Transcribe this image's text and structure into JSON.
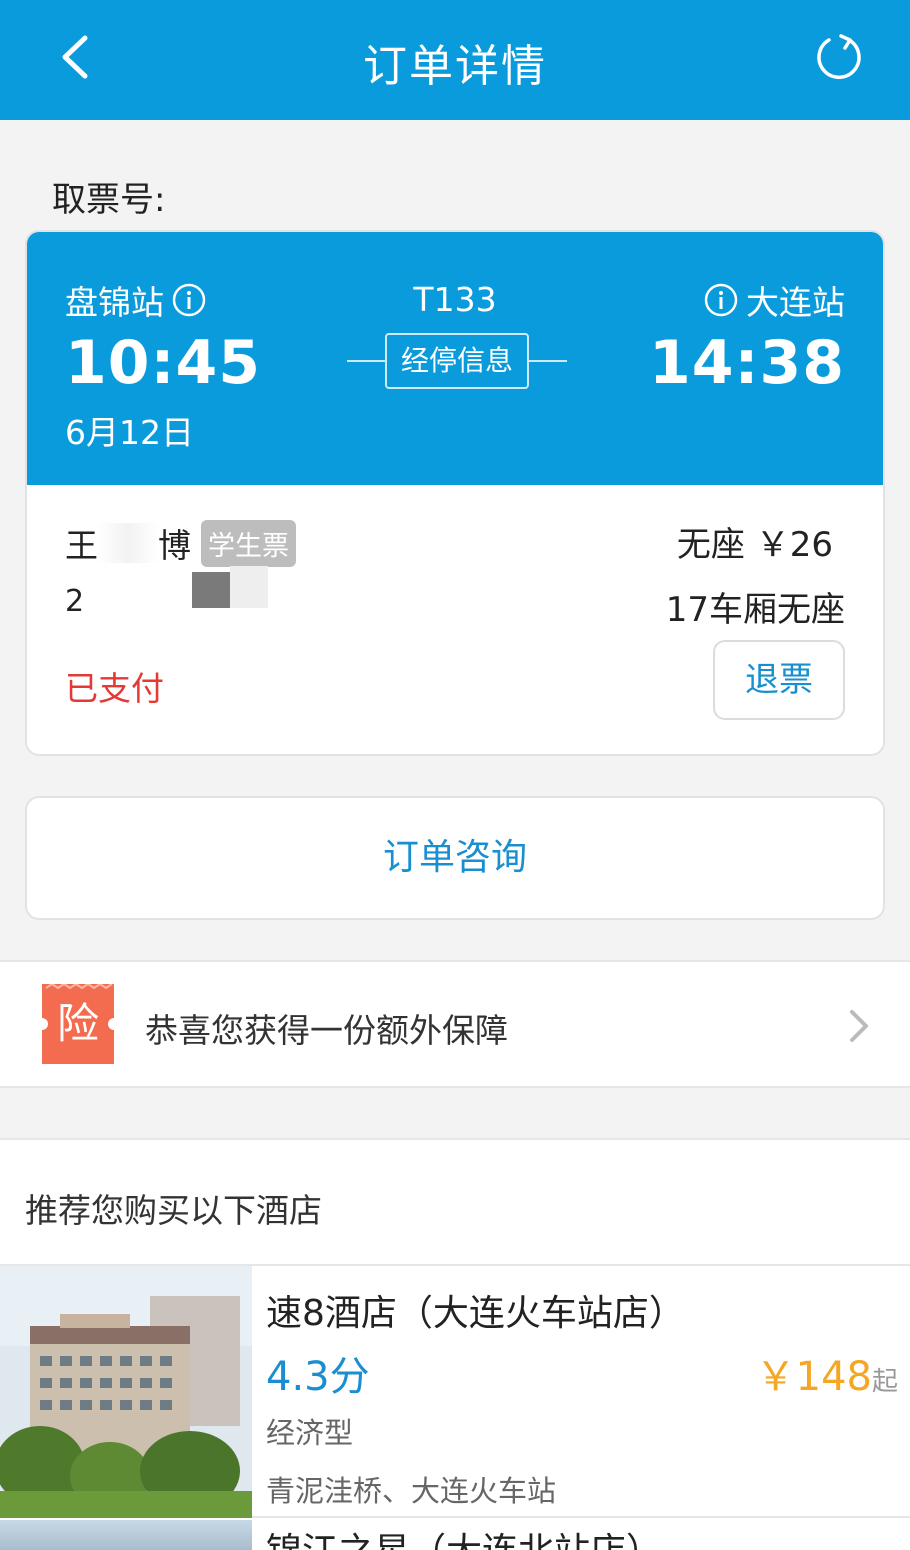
{
  "header": {
    "title": "订单详情"
  },
  "pickup": {
    "label": "取票号:"
  },
  "ticket": {
    "from_station": "盘锦站",
    "to_station": "大连站",
    "train_no": "T133",
    "stops_label": "经停信息",
    "depart_time": "10:45",
    "arrive_time": "14:38",
    "depart_date": "6月12日",
    "passenger_name": "王博",
    "passenger_name_first": "王",
    "passenger_name_last": "博",
    "ticket_type": "学生票",
    "passenger_id_prefix": "2",
    "seat_price": "无座 ￥26",
    "seat_car": "17车厢无座",
    "status": "已支付",
    "refund_label": "退票"
  },
  "consult": {
    "label": "订单咨询"
  },
  "insurance": {
    "icon_char": "险",
    "text": "恭喜您获得一份额外保障"
  },
  "hotels": {
    "title": "推荐您购买以下酒店",
    "items": [
      {
        "name": "速8酒店（大连火车站店）",
        "score": "4.3分",
        "price": "￥148",
        "price_suffix": "起",
        "type": "经济型",
        "location": "青泥洼桥、大连火车站"
      },
      {
        "name": "锦江之星（大连北站店）"
      }
    ]
  },
  "colors": {
    "primary": "#0a9bdc",
    "link": "#1a8fd0",
    "paid": "#e53935",
    "price": "#f5a623",
    "insurance_icon": "#f36c4f"
  },
  "icons": {
    "back": "chevron-left-icon",
    "refresh": "refresh-icon",
    "info": "info-icon",
    "insurance": "insurance-ticket-icon",
    "arrow": "chevron-right-icon"
  }
}
